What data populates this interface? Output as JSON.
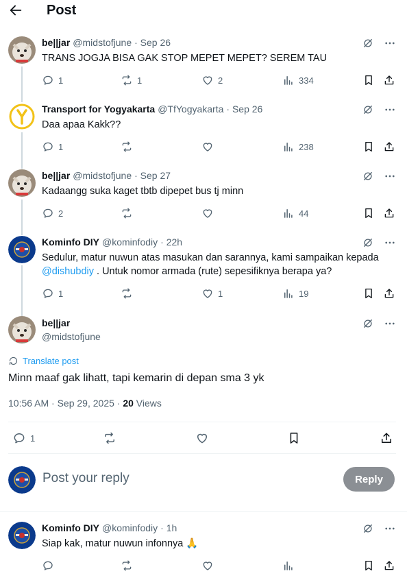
{
  "header": {
    "title": "Post"
  },
  "tweets": [
    {
      "name": "be||jar",
      "handle": "@midstofjune",
      "time": "· Sep 26",
      "text": "TRANS JOGJA BISA GAK STOP MEPET MEPET? SEREM TAU",
      "replies": "1",
      "reposts": "1",
      "likes": "2",
      "views": "334"
    },
    {
      "name": "Transport for Yogyakarta",
      "handle": "@TfYogyakarta",
      "time": "· Sep 26",
      "text": "Daa apaa Kakk??",
      "replies": "1",
      "reposts": "",
      "likes": "",
      "views": "238"
    },
    {
      "name": "be||jar",
      "handle": "@midstofjune",
      "time": "· Sep 27",
      "text": "Kadaangg suka kaget tbtb dipepet bus tj minn",
      "replies": "2",
      "reposts": "",
      "likes": "",
      "views": "44"
    },
    {
      "name": "Kominfo DIY",
      "handle": "@kominfodiy",
      "time": "· 22h",
      "text_before": "Sedulur, matur nuwun atas masukan dan sarannya, kami sampaikan kepada ",
      "mention": "@dishubdiy",
      "text_after": " . Untuk nomor armada (rute) sepesifiknya berapa ya?",
      "replies": "1",
      "reposts": "",
      "likes": "1",
      "views": "19"
    }
  ],
  "main_post": {
    "name": "be||jar",
    "handle": "@midstofjune",
    "translate": "Translate post",
    "text": "Minn maaf gak lihatt, tapi kemarin di depan sma 3 yk",
    "timestamp": "10:56 AM · Sep 29, 2025 · ",
    "views_count": "20",
    "views_label": " Views",
    "replies": "1"
  },
  "composer": {
    "placeholder": "Post your reply",
    "button": "Reply"
  },
  "last_reply": {
    "name": "Kominfo DIY",
    "handle": "@kominfodiy",
    "time": "· 1h",
    "text": "Siap kak, matur nuwun infonnya 🙏"
  },
  "colors": {
    "accent": "#1d9bf0",
    "muted": "#536471",
    "text": "#0f1419",
    "reply_button": "#8b8f94"
  }
}
